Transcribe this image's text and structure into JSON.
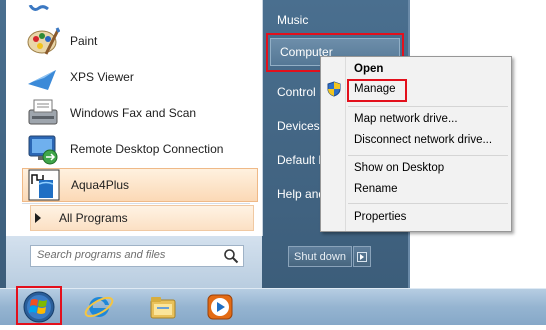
{
  "start_menu": {
    "programs": [
      {
        "label": "Paint",
        "icon": "paint-icon"
      },
      {
        "label": "XPS Viewer",
        "icon": "xps-viewer-icon"
      },
      {
        "label": "Windows Fax and Scan",
        "icon": "fax-scan-icon"
      },
      {
        "label": "Remote Desktop Connection",
        "icon": "remote-desktop-icon"
      },
      {
        "label": "Aqua4Plus",
        "icon": "aqua4plus-icon"
      }
    ],
    "all_programs_label": "All Programs",
    "search_placeholder": "Search programs and files",
    "right_items": [
      {
        "label": "Music"
      },
      {
        "label": "Computer"
      },
      {
        "label": "Control P"
      },
      {
        "label": "Devices a"
      },
      {
        "label": "Default P"
      },
      {
        "label": "Help and"
      }
    ],
    "shutdown_label": "Shut down"
  },
  "context_menu": {
    "items": [
      {
        "label": "Open"
      },
      {
        "label": "Manage"
      },
      {
        "label": "Map network drive..."
      },
      {
        "label": "Disconnect network drive..."
      },
      {
        "label": "Show on Desktop"
      },
      {
        "label": "Rename"
      },
      {
        "label": "Properties"
      }
    ]
  },
  "taskbar": {
    "icons": [
      "start-orb-icon",
      "internet-explorer-icon",
      "windows-explorer-icon",
      "media-player-icon"
    ]
  },
  "colors": {
    "highlight_red": "#e3101c",
    "menu_blue": "#3c5d7a",
    "aqua_highlight": "#fbd9b6"
  }
}
